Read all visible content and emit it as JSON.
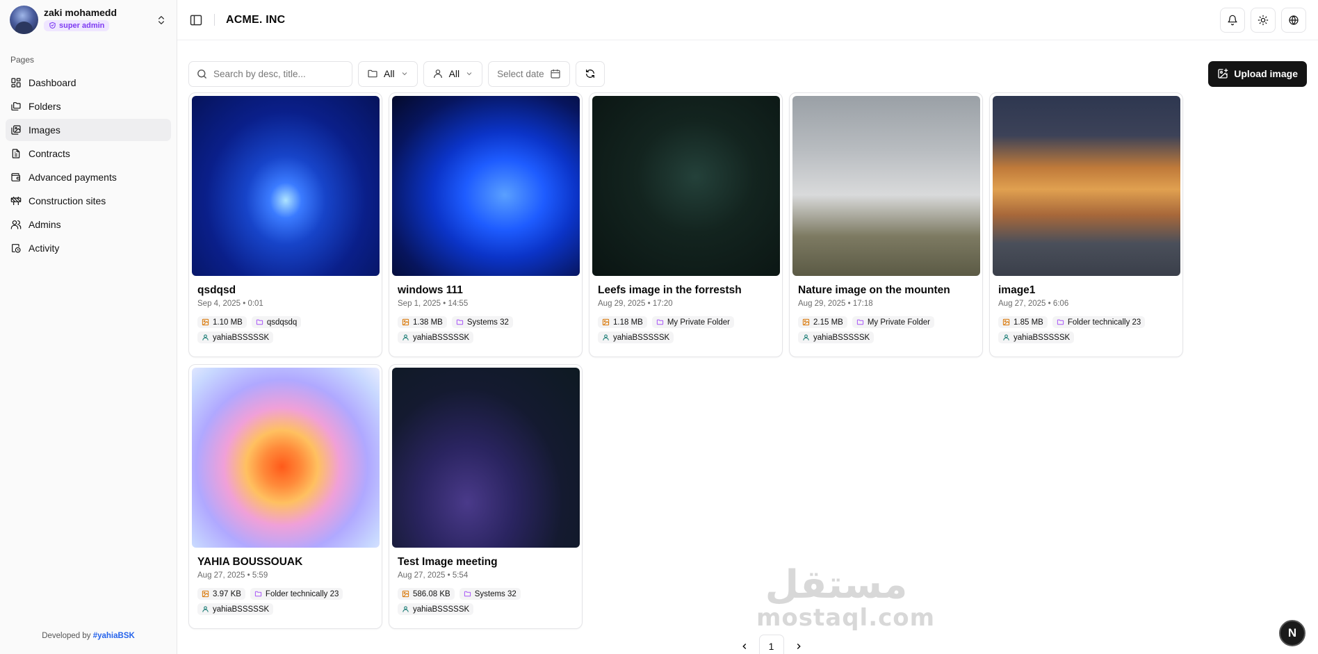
{
  "user": {
    "name": "zaki mohamedd",
    "role": "super admin"
  },
  "sidebar": {
    "section_label": "Pages",
    "items": [
      {
        "label": "Dashboard",
        "icon": "dashboard-icon"
      },
      {
        "label": "Folders",
        "icon": "folders-icon"
      },
      {
        "label": "Images",
        "icon": "images-icon",
        "active": true
      },
      {
        "label": "Contracts",
        "icon": "contracts-icon"
      },
      {
        "label": "Advanced payments",
        "icon": "wallet-icon"
      },
      {
        "label": "Construction sites",
        "icon": "construction-icon"
      },
      {
        "label": "Admins",
        "icon": "users-icon"
      },
      {
        "label": "Activity",
        "icon": "activity-icon"
      }
    ],
    "footer_prefix": "Developed by",
    "footer_handle": "#yahiaBSK"
  },
  "header": {
    "brand": "ACME. INC"
  },
  "filters": {
    "search_placeholder": "Search by desc, title...",
    "folder_filter": "All",
    "user_filter": "All",
    "date_placeholder": "Select date",
    "upload_label": "Upload image"
  },
  "images": [
    {
      "title": "qsdqsd",
      "date": "Sep 4, 2025 • 0:01",
      "size": "1.10 MB",
      "folder": "qsdqsdq",
      "owner": "yahiaBSSSSSK"
    },
    {
      "title": "windows 111",
      "date": "Sep 1, 2025 • 14:55",
      "size": "1.38 MB",
      "folder": "Systems 32",
      "owner": "yahiaBSSSSSK"
    },
    {
      "title": "Leefs image in the forrestsh",
      "date": "Aug 29, 2025 • 17:20",
      "size": "1.18 MB",
      "folder": "My Private Folder",
      "owner": "yahiaBSSSSSK"
    },
    {
      "title": "Nature image on the mounten",
      "date": "Aug 29, 2025 • 17:18",
      "size": "2.15 MB",
      "folder": "My Private Folder",
      "owner": "yahiaBSSSSSK"
    },
    {
      "title": "image1",
      "date": "Aug 27, 2025 • 6:06",
      "size": "1.85 MB",
      "folder": "Folder technically 23",
      "owner": "yahiaBSSSSSK"
    },
    {
      "title": "YAHIA BOUSSOUAK",
      "date": "Aug 27, 2025 • 5:59",
      "size": "3.97 KB",
      "folder": "Folder technically 23",
      "owner": "yahiaBSSSSSK"
    },
    {
      "title": "Test Image meeting",
      "date": "Aug 27, 2025 • 5:54",
      "size": "586.08 KB",
      "folder": "Systems 32",
      "owner": "yahiaBSSSSSK"
    }
  ],
  "pagination": {
    "current": "1"
  },
  "fab": {
    "label": "N"
  },
  "watermark": {
    "arabic": "مستقل",
    "latin": "mostaql.com"
  },
  "colors": {
    "accent": "#7e3af2",
    "primary_button": "#141414",
    "link": "#2563eb",
    "size_icon": "#d97706",
    "folder_icon": "#a855f7",
    "owner_icon": "#0f766e"
  }
}
